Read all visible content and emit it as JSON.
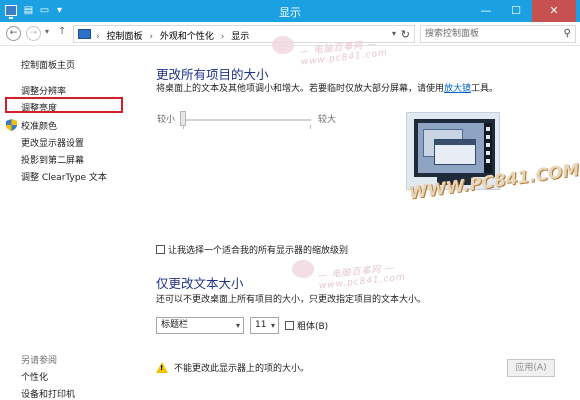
{
  "window": {
    "title": "显示",
    "minimize_glyph": "—",
    "maximize_glyph": "☐",
    "close_glyph": "✕"
  },
  "address": {
    "crumbs": [
      "控制面板",
      "外观和个性化",
      "显示"
    ],
    "search_placeholder": "搜索控制面板"
  },
  "sidebar": {
    "home": "控制面板主页",
    "items": [
      "调整分辨率",
      "调整亮度",
      "校准颜色",
      "更改显示器设置",
      "投影到第二屏幕",
      "调整 ClearType 文本"
    ],
    "see_also_label": "另请参阅",
    "see_also": [
      "个性化",
      "设备和打印机"
    ]
  },
  "main": {
    "heading1": "更改所有项目的大小",
    "desc1_before": "将桌面上的文本及其他项调小和增大。若要临时仅放大部分屏幕，请使用",
    "desc1_link": "放大镜",
    "desc1_after": "工具。",
    "slider_small": "较小",
    "slider_large": "较大",
    "slider_value_fraction": 0,
    "checkbox_label": "让我选择一个适合我的所有显示器的缩放级别",
    "heading2": "仅更改文本大小",
    "desc2": "还可以不更改桌面上所有项目的大小，只更改指定项目的文本大小。",
    "item_select": "标题栏",
    "size_select": "11",
    "bold_label": "粗体(B)",
    "warning": "不能更改此显示器上的项的大小。",
    "apply_button": "应用(A)"
  },
  "watermarks": {
    "small_text": "— 电脑百事网 —",
    "small_url": "www.pc841.com",
    "big_text": "WWW.PC841.COM"
  },
  "colors": {
    "titlebar": "#1ba1e2",
    "heading": "#1e3287",
    "link": "#0066cc",
    "highlight_box": "#d31f27"
  }
}
